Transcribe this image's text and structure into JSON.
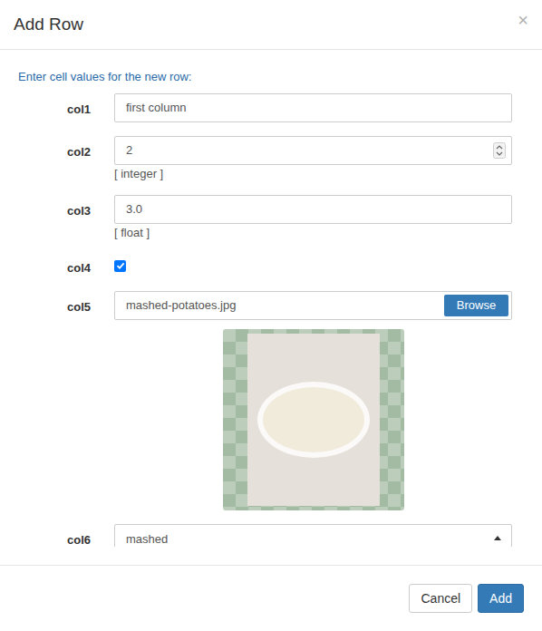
{
  "dialog": {
    "title": "Add Row",
    "close": "×",
    "intro": "Enter cell values for the new row:"
  },
  "fields": [
    {
      "label": "col1",
      "kind": "text",
      "value": "first column"
    },
    {
      "label": "col2",
      "kind": "number",
      "value": "2",
      "hint": "[ integer ]"
    },
    {
      "label": "col3",
      "kind": "text",
      "value": "3.0",
      "hint": "[ float ]"
    },
    {
      "label": "col4",
      "kind": "checkbox",
      "checked": true
    },
    {
      "label": "col5",
      "kind": "file",
      "value": "mashed-potatoes.jpg",
      "button": "Browse"
    },
    {
      "label": "col6",
      "kind": "select",
      "value": "mashed"
    }
  ],
  "buttons": [
    {
      "label": "Cancel",
      "primary": false
    },
    {
      "label": "Add",
      "primary": true
    }
  ]
}
